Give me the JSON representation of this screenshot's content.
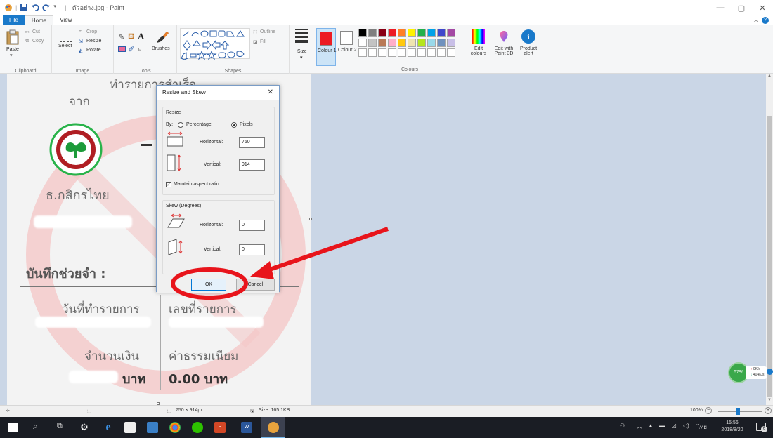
{
  "window": {
    "title": "ตัวอย่าง.jpg - Paint",
    "controls": [
      "—",
      "▢",
      "✕"
    ]
  },
  "tabs": {
    "file": "File",
    "home": "Home",
    "view": "View"
  },
  "ribbon": {
    "clipboard": {
      "label": "Clipboard",
      "paste": "Paste",
      "cut": "Cut",
      "copy": "Copy"
    },
    "image": {
      "label": "Image",
      "select": "Select",
      "crop": "Crop",
      "resize": "Resize",
      "rotate": "Rotate"
    },
    "tools": {
      "label": "Tools",
      "brushes": "Brushes"
    },
    "shapes": {
      "label": "Shapes",
      "outline": "Outline",
      "fill": "Fill"
    },
    "size": "Size",
    "colour1": "Colour 1",
    "colour2": "Colour 2",
    "colours": {
      "label": "Colours",
      "edit": "Edit colours"
    },
    "paint3d": "Edit with Paint 3D",
    "product_alert": "Product alert",
    "palette": [
      "#000000",
      "#7f7f7f",
      "#880015",
      "#ed1c24",
      "#ff7f27",
      "#fff200",
      "#22b14c",
      "#00a2e8",
      "#3f48cc",
      "#a349a4",
      "#ffffff",
      "#c3c3c3",
      "#b97a57",
      "#ffaec9",
      "#ffc90e",
      "#efe4b0",
      "#b5e61d",
      "#99d9ea",
      "#7092be",
      "#c8bfe7"
    ],
    "colour1_value": "#ed1c24",
    "colour2_value": "#ffffff"
  },
  "receipt": {
    "heading": "ทำรายการสำเร็จ",
    "from": "จาก",
    "bank": "ธ.กสิกรไทย",
    "memo": "บันทึกช่วยจำ :",
    "date_label": "วันที่ทำรายการ",
    "ref_label": "เลขที่รายการ",
    "amount_label": "จำนวนเงิน",
    "fee_label": "ค่าธรรมเนียม",
    "currency": "บาท",
    "fee_value": "0.00 บาท"
  },
  "dialog": {
    "title": "Resize and Skew",
    "resize_label": "Resize",
    "by": "By:",
    "percentage": "Percentage",
    "pixels": "Pixels",
    "horizontal": "Horizontal:",
    "vertical": "Vertical:",
    "resize_h": "750",
    "resize_v": "914",
    "maintain": "Maintain aspect ratio",
    "skew_label": "Skew (Degrees)",
    "skew_h": "0",
    "skew_v": "0",
    "ok": "OK",
    "cancel": "Cancel"
  },
  "status": {
    "dimensions": "750 × 914px",
    "size": "Size: 165.1KB",
    "zoom": "100%"
  },
  "network_widget": {
    "percent": "67%",
    "up": "0K/s",
    "down": "404K/s"
  },
  "tray": {
    "lang": "ไทย",
    "time": "15:56",
    "date": "2018/8/20",
    "notif": "6"
  }
}
